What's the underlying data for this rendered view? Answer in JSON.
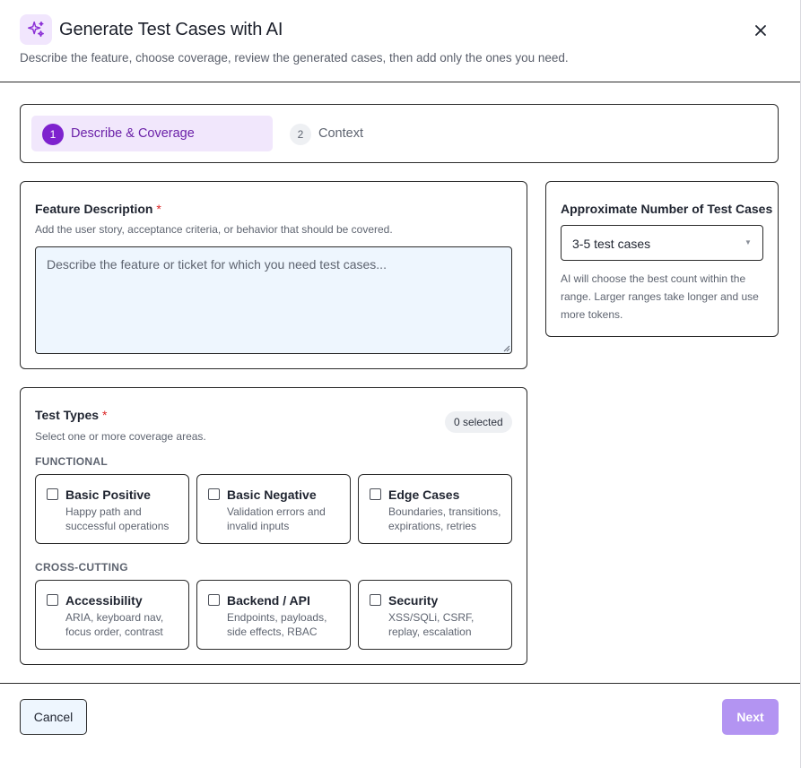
{
  "dialog": {
    "title": "Generate Test Cases with AI",
    "subtitle": "Describe the feature, choose coverage, review the generated cases, then add only the ones you need.",
    "title_icon": "sparkles-icon",
    "close_icon": "close-icon"
  },
  "stepper": {
    "steps": [
      {
        "number": "1",
        "label": "Describe & Coverage",
        "active": true
      },
      {
        "number": "2",
        "label": "Context",
        "active": false
      }
    ]
  },
  "feature": {
    "label": "Feature Description",
    "required_mark": "*",
    "hint": "Add the user story, acceptance criteria, or behavior that should be covered.",
    "value": "",
    "placeholder": "Describe the feature or ticket for which you need test cases..."
  },
  "count": {
    "label": "Approximate Number of Test Cases",
    "selected": "3-5 test cases",
    "hint": "AI will choose the best count within the range. Larger ranges take longer and use more tokens."
  },
  "test_types": {
    "label": "Test Types",
    "required_mark": "*",
    "hint": "Select one or more coverage areas.",
    "selected_badge": "0 selected",
    "groups": [
      {
        "title": "FUNCTIONAL",
        "options": [
          {
            "title": "Basic Positive",
            "desc": "Happy path and successful operations",
            "checked": false
          },
          {
            "title": "Basic Negative",
            "desc": "Validation errors and invalid inputs",
            "checked": false
          },
          {
            "title": "Edge Cases",
            "desc": "Boundaries, transitions, expirations, retries",
            "checked": false
          }
        ]
      },
      {
        "title": "CROSS-CUTTING",
        "options": [
          {
            "title": "Accessibility",
            "desc": "ARIA, keyboard nav, focus order, contrast",
            "checked": false
          },
          {
            "title": "Backend / API",
            "desc": "Endpoints, payloads, side effects, RBAC",
            "checked": false
          },
          {
            "title": "Security",
            "desc": "XSS/SQLi, CSRF, replay, escalation",
            "checked": false
          }
        ]
      }
    ]
  },
  "footer": {
    "cancel_label": "Cancel",
    "next_label": "Next"
  },
  "colors": {
    "accent": "#7e22ce",
    "accent_soft": "#f1e7fc",
    "next_disabled": "#b394f2",
    "required": "#dc2626"
  }
}
